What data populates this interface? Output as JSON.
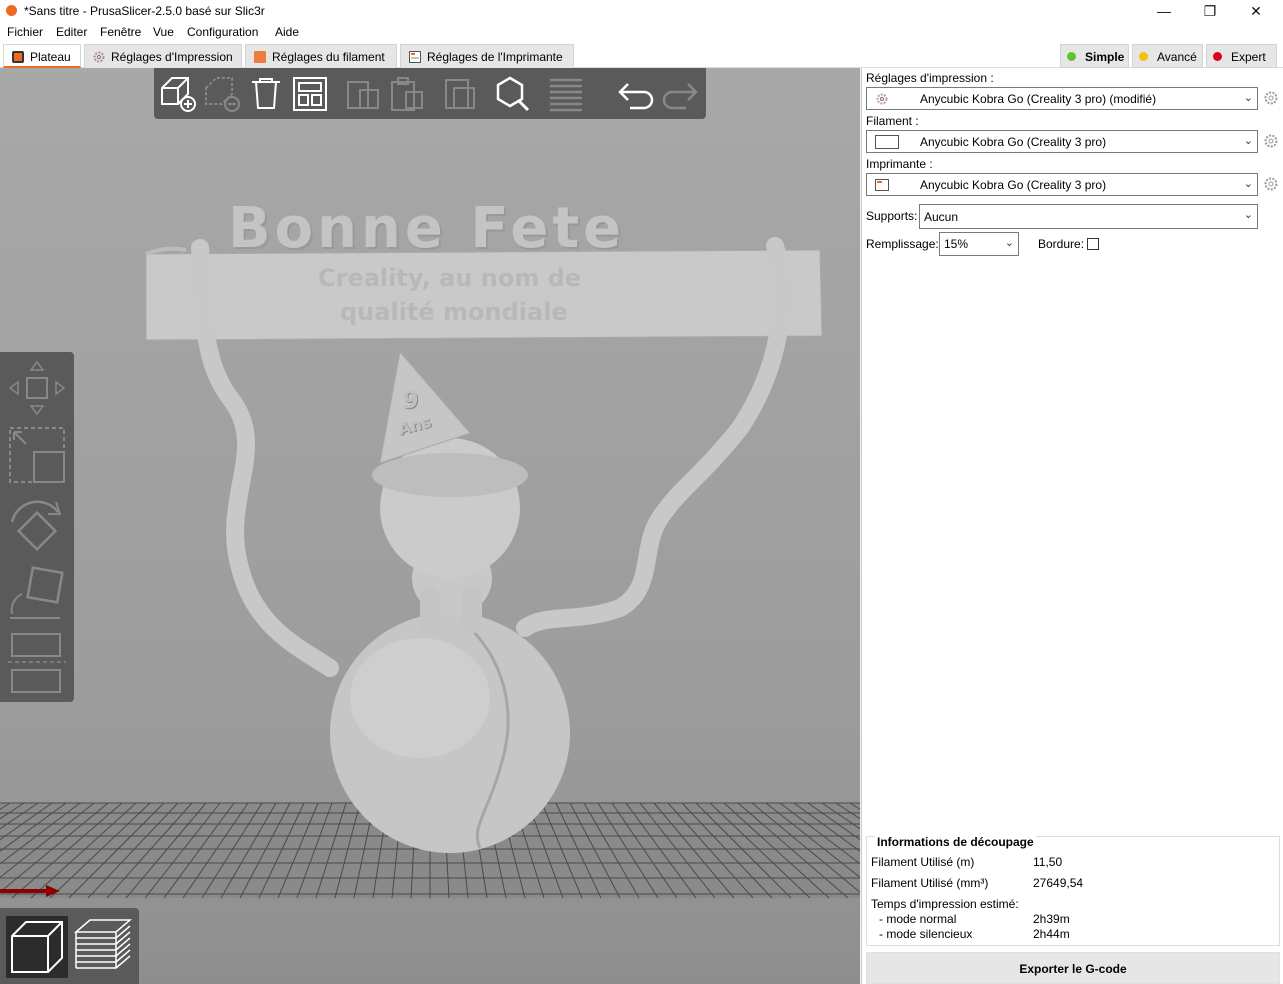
{
  "window": {
    "title": "*Sans titre - PrusaSlicer-2.5.0 basé sur Slic3r",
    "minimize_glyph": "—",
    "maximize_glyph": "❐",
    "close_glyph": "✕"
  },
  "menu": [
    "Fichier",
    "Editer",
    "Fenêtre",
    "Vue",
    "Configuration",
    "Aide"
  ],
  "tabs": [
    {
      "label": "Plateau",
      "icon": "plater-icon"
    },
    {
      "label": "Réglages d'Impression",
      "icon": "gear-icon"
    },
    {
      "label": "Réglages du filament",
      "icon": "spool-icon"
    },
    {
      "label": "Réglages de l'Imprimante",
      "icon": "printer-icon"
    }
  ],
  "modes": [
    {
      "label": "Simple",
      "color": "#5fc230"
    },
    {
      "label": "Avancé",
      "color": "#f4c20d"
    },
    {
      "label": "Expert",
      "color": "#e0001b"
    }
  ],
  "colors": {
    "accent": "#ed6b21",
    "toolbar": "#5a5a5a",
    "model": "#c8c8c8"
  },
  "model_text": {
    "line1": "Bonne Fete",
    "line2": "Creality, au nom de",
    "line3": "qualité mondiale",
    "hat_number": "9",
    "hat_text": "Ans"
  },
  "sidebar": {
    "print_label": "Réglages d'impression :",
    "print_value": "Anycubic Kobra Go (Creality 3 pro) (modifié)",
    "filament_label": "Filament :",
    "filament_value": "Anycubic Kobra Go (Creality 3 pro)",
    "printer_label": "Imprimante :",
    "printer_value": "Anycubic Kobra Go (Creality 3 pro)",
    "supports_label": "Supports:",
    "supports_value": "Aucun",
    "infill_label": "Remplissage:",
    "infill_value": "15%",
    "brim_label": "Bordure:"
  },
  "slice_info": {
    "title": "Informations de découpage",
    "filament_m_label": "Filament Utilisé (m)",
    "filament_m_value": "11,50",
    "filament_mm3_label": "Filament Utilisé (mm³)",
    "filament_mm3_value": "27649,54",
    "time_label": "Temps d'impression estimé:",
    "normal_label": "- mode normal",
    "normal_value": "2h39m",
    "silent_label": "- mode silencieux",
    "silent_value": "2h44m"
  },
  "export_label": "Exporter le G-code"
}
